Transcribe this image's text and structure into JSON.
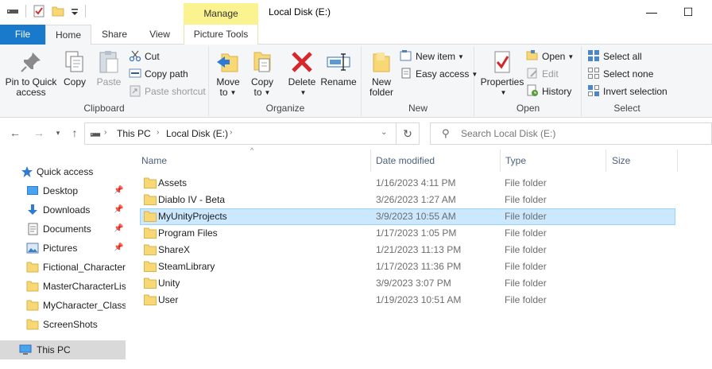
{
  "window": {
    "manage_label": "Manage",
    "title": "Local Disk (E:)",
    "minimize": "—",
    "maximize": "☐"
  },
  "tabs": [
    {
      "label": "File"
    },
    {
      "label": "Home"
    },
    {
      "label": "Share"
    },
    {
      "label": "View"
    },
    {
      "label": "Picture Tools"
    }
  ],
  "ribbon": {
    "clipboard": {
      "label": "Clipboard",
      "pin_line1": "Pin to Quick",
      "pin_line2": "access",
      "copy": "Copy",
      "paste": "Paste",
      "cut": "Cut",
      "copy_path": "Copy path",
      "paste_shortcut": "Paste shortcut"
    },
    "organize": {
      "label": "Organize",
      "move_to": "Move",
      "move_to2": "to",
      "copy_to": "Copy",
      "copy_to2": "to",
      "delete": "Delete",
      "rename": "Rename"
    },
    "new": {
      "label": "New",
      "new_folder1": "New",
      "new_folder2": "folder",
      "new_item": "New item",
      "easy_access": "Easy access"
    },
    "open": {
      "label": "Open",
      "properties": "Properties",
      "open": "Open",
      "edit": "Edit",
      "history": "History"
    },
    "select": {
      "label": "Select",
      "select_all": "Select all",
      "select_none": "Select none",
      "invert": "Invert selection"
    }
  },
  "address": {
    "crumbs": [
      "This PC",
      "Local Disk (E:)"
    ],
    "search_placeholder": "Search Local Disk (E:)"
  },
  "navpane": {
    "quick_access": "Quick access",
    "items": [
      {
        "label": "Desktop",
        "pinned": true
      },
      {
        "label": "Downloads",
        "pinned": true
      },
      {
        "label": "Documents",
        "pinned": true
      },
      {
        "label": "Pictures",
        "pinned": true
      },
      {
        "label": "Fictional_Character_",
        "pinned": false
      },
      {
        "label": "MasterCharacterList",
        "pinned": false
      },
      {
        "label": "MyCharacter_Classe",
        "pinned": false
      },
      {
        "label": "ScreenShots",
        "pinned": false
      }
    ],
    "this_pc": "This PC"
  },
  "filelist": {
    "columns": [
      "Name",
      "Date modified",
      "Type",
      "Size"
    ],
    "rows": [
      {
        "name": "Assets",
        "date": "1/16/2023 4:11 PM",
        "type": "File folder"
      },
      {
        "name": "Diablo IV - Beta",
        "date": "3/26/2023 1:27 AM",
        "type": "File folder"
      },
      {
        "name": "MyUnityProjects",
        "date": "3/9/2023 10:55 AM",
        "type": "File folder"
      },
      {
        "name": "Program Files",
        "date": "1/17/2023 1:05 PM",
        "type": "File folder"
      },
      {
        "name": "ShareX",
        "date": "1/21/2023 11:13 PM",
        "type": "File folder"
      },
      {
        "name": "SteamLibrary",
        "date": "1/17/2023 11:36 PM",
        "type": "File folder"
      },
      {
        "name": "Unity",
        "date": "3/9/2023 3:07 PM",
        "type": "File folder"
      },
      {
        "name": "User",
        "date": "1/19/2023 10:51 AM",
        "type": "File folder"
      }
    ],
    "selected_index": 2
  },
  "colors": {
    "file_tab": "#1979ca",
    "manage_tab": "#fbf38f",
    "selection": "#cce8ff",
    "folder": "#f8d775"
  }
}
